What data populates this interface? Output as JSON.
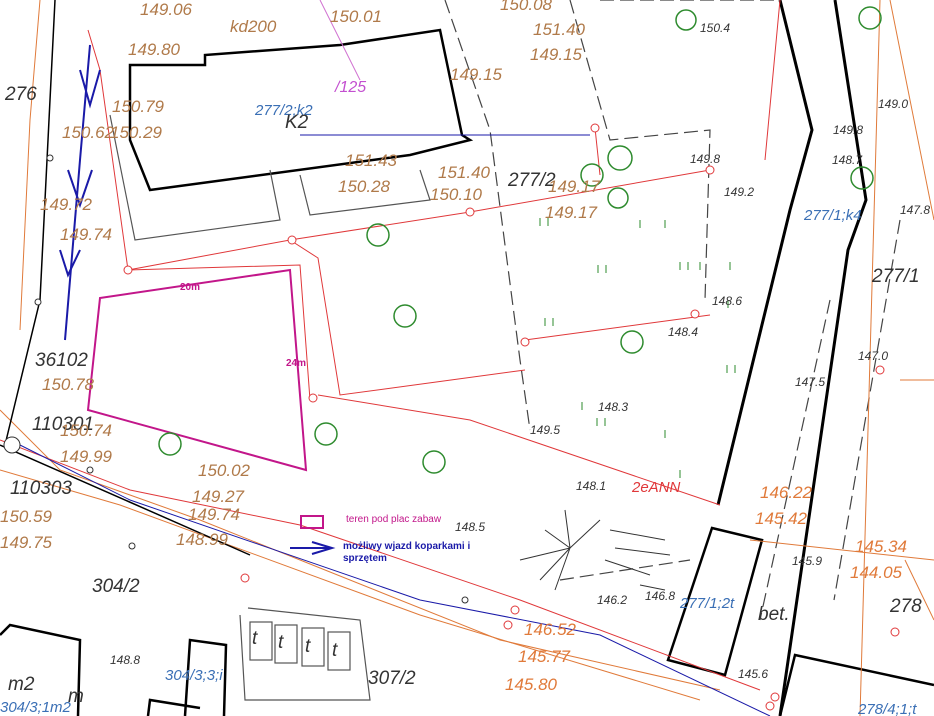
{
  "parcels": {
    "main": "277/2",
    "building_parcel": "277/2;k2",
    "building_code": "K2",
    "right": "277/1",
    "right_small": "277/1;k4",
    "left_top": "276",
    "p304": "304/2",
    "p307": "307/2",
    "p304_3": "304/3;3;i",
    "p304_3b": "304/3;1m2",
    "p277_1_2t": "277/1;2t",
    "p278": "278",
    "p278_4": "278/4;1;t",
    "p125": "/125",
    "kd": "kd200",
    "bet": "bet.",
    "t_label": "t",
    "m2": "m2",
    "m": "m",
    "code_36102": "36102",
    "code_110301": "110301",
    "code_110303": "110303",
    "code_2eann": "2eANN"
  },
  "elevations_brown": [
    "150.08",
    "151.40",
    "149.15",
    "150.01",
    "149.15",
    "151.43",
    "150.28",
    "151.40",
    "150.10",
    "149.17",
    "149.17",
    "149.06",
    "149.80",
    "149.74",
    "149.72",
    "150.79",
    "150.62",
    "150.29",
    "150.78",
    "150.74",
    "149.99",
    "150.02",
    "149.27",
    "149.74",
    "148.99",
    "150.59",
    "149.75",
    "146.22",
    "145.42",
    "145.34",
    "144.05",
    "146.52",
    "145.77",
    "145.80"
  ],
  "elevations_dark": [
    "150.4",
    "149.0",
    "149.8",
    "148.7",
    "149.8",
    "149.2",
    "147.8",
    "148.6",
    "148.4",
    "147.0",
    "147.5",
    "148.3",
    "149.5",
    "148.1",
    "148.5",
    "146.2",
    "146.8",
    "145.9",
    "145.6",
    "148.8"
  ],
  "playground": {
    "width_label": "20m",
    "height_label": "24m"
  },
  "legend": {
    "playground_label": "teren pod plac zabaw",
    "access_label": "możliwy wjazd koparkami i sprzętem",
    "playground_color": "#c2168a",
    "access_color": "#1a1aa8"
  },
  "colors": {
    "boundary": "#e0383a",
    "contour": "#e07a3a",
    "building": "#000000",
    "tree": "#2e8b2e",
    "access_arrow": "#1a1aa8"
  }
}
